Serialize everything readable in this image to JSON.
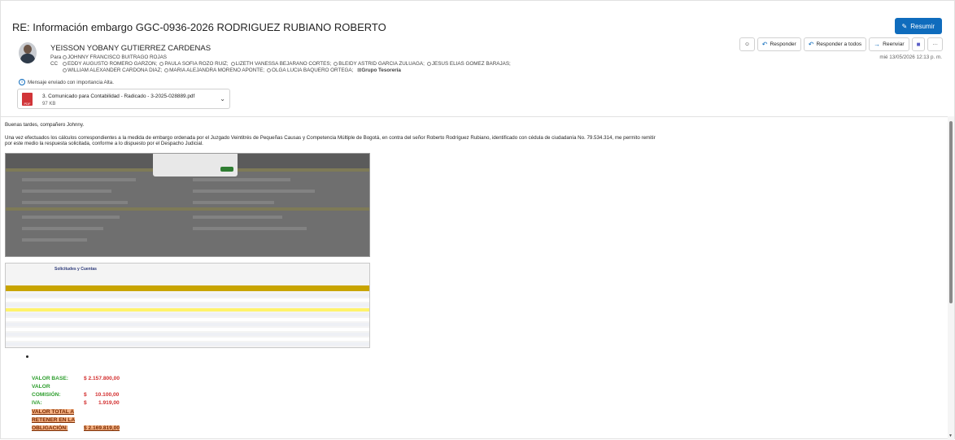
{
  "subject": "RE: Información embargo GGC-0936-2026 RODRIGUEZ RUBIANO ROBERTO",
  "summary_button": "Resumir",
  "sender": "YEISSON YOBANY GUTIERREZ CARDENAS",
  "to_label": "Para",
  "to": [
    "JOHNNY FRANCISCO BUITRAGO ROJAS"
  ],
  "cc_label": "CC",
  "cc_line1": [
    "EDDY AUGUSTO ROMERO GARZON;",
    "PAULA SOFIA ROZO RUIZ;",
    "LIZETH VANESSA BEJARANO CORTES;",
    "BLEIDY ASTRID GARCIA ZULUAGA;",
    "JESUS ELIAS GOMEZ BARAJAS;"
  ],
  "cc_line2": [
    "WILLIAM ALEXANDER CARDONA DIAZ;",
    "MARIA ALEJANDRA MORENO APONTE;",
    "OLGA LUCIA BAQUERO ORTEGA;"
  ],
  "cc_group": "Grupo Tesorería",
  "actions": {
    "reply": "Responder",
    "reply_all": "Responder a todos",
    "forward": "Reenviar"
  },
  "date": "mié 13/05/2026 12:13 p. m.",
  "importance": "Mensaje enviado con importancia Alta.",
  "attachment": {
    "name": "3. Comunicado para Contabilidad - Radicado - 3-2025-028889.pdf",
    "size": "97 KB",
    "icon": "pdf-icon"
  },
  "body": {
    "greeting": "Buenas tardes, compañero Johnny.",
    "paragraph_line1": "Una vez efectuados los cálculos correspondientes a la medida de embargo ordenada por el Juzgado Veintitrés de Pequeñas Causas y Competencia Múltiple de Bogotá, en contra del señor Roberto Rodríguez Rubiano, identificado con cédula de ciudadanía No. 79.534.314, me permito remitir",
    "paragraph_line2": "por este medio la respuesta solicitada, conforme a lo dispuesto por el Despacho Judicial."
  },
  "embedded": {
    "title": "Solicitudes y Cuentas"
  },
  "values": {
    "base_label": "VALOR BASE:",
    "base_value": "$ 2.157.800,00",
    "commission_label_1": "VALOR",
    "commission_label_2": "COMISIÓN:",
    "commission_currency": "$",
    "commission_value": "10.100,00",
    "iva_label": "IVA:",
    "iva_currency": "$",
    "iva_value": "1.919,00",
    "total_label_1": "VALOR TOTAL A",
    "total_label_2": "RETENER EN LA",
    "total_label_3": "OBLIGACIÓN:",
    "total_value": "$ 2.169.819,00"
  }
}
